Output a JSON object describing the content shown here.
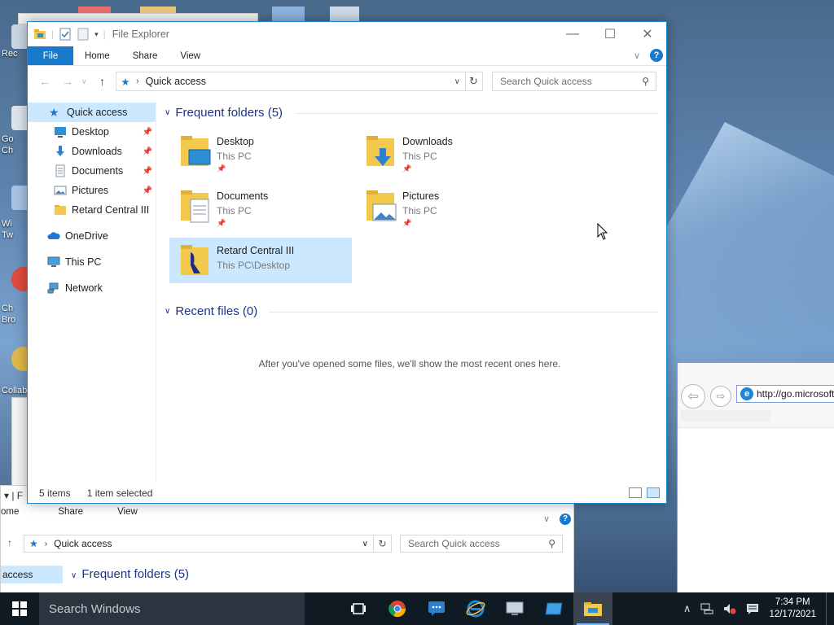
{
  "window": {
    "title": "File Explorer",
    "minimize_glyph": "—",
    "maximize_glyph": "☐",
    "close_glyph": "✕"
  },
  "ribbon": {
    "tabs": [
      "File",
      "Home",
      "Share",
      "View"
    ],
    "help_glyph": "?"
  },
  "address": {
    "path": "Quick access",
    "search_placeholder": "Search Quick access"
  },
  "sidebar": {
    "items": [
      {
        "label": "Quick access",
        "icon": "star-icon"
      },
      {
        "label": "Desktop",
        "icon": "desktop-folder-icon",
        "pinned": true
      },
      {
        "label": "Downloads",
        "icon": "downloads-folder-icon",
        "pinned": true
      },
      {
        "label": "Documents",
        "icon": "documents-folder-icon",
        "pinned": true
      },
      {
        "label": "Pictures",
        "icon": "pictures-folder-icon",
        "pinned": true
      },
      {
        "label": "Retard Central III",
        "icon": "folder-icon"
      },
      {
        "label": "OneDrive",
        "icon": "cloud-icon"
      },
      {
        "label": "This PC",
        "icon": "computer-icon"
      },
      {
        "label": "Network",
        "icon": "network-icon"
      }
    ]
  },
  "frequent": {
    "header": "Frequent folders (5)",
    "folders": [
      {
        "name": "Desktop",
        "location": "This PC"
      },
      {
        "name": "Downloads",
        "location": "This PC"
      },
      {
        "name": "Documents",
        "location": "This PC"
      },
      {
        "name": "Pictures",
        "location": "This PC"
      },
      {
        "name": "Retard Central III",
        "location": "This PC\\Desktop"
      }
    ]
  },
  "recent": {
    "header": "Recent files (0)",
    "empty_message": "After you've opened some files, we'll show the most recent ones here."
  },
  "status": {
    "count": "5 items",
    "selection": "1 item selected"
  },
  "bg_window": {
    "tabs": [
      "ome",
      "Share",
      "View"
    ],
    "path": "Quick access",
    "search_placeholder": "Search Quick access",
    "selected_item": "access",
    "header": "Frequent folders (5)"
  },
  "ie": {
    "url": "http://go.microsoft"
  },
  "desktop_labels": [
    "Rec",
    "Go Ch",
    "Wi Tw",
    "Ch Bro",
    "Collab"
  ],
  "taskbar": {
    "search_text": "Search Windows",
    "time": "7:34 PM",
    "date": "12/17/2021"
  }
}
